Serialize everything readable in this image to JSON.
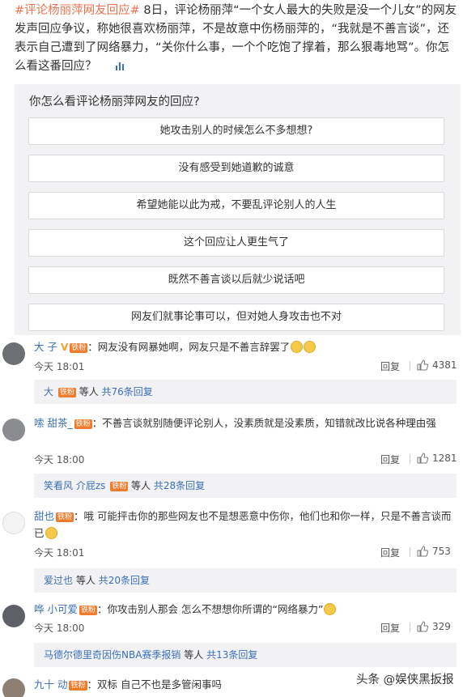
{
  "post": {
    "hashtag": "#评论杨丽萍网友回应#",
    "text": " 8日，评论杨丽萍“一个女人最大的失败是没一个儿女”的网友发声回应争议，称她很喜欢杨丽萍，不是故意中伤杨丽萍的，“我就是不善言谈”，还表示自己遭到了网络暴力，“关你什么事，一个个吃饱了撑着，那么狠毒地骂”。",
    "tail_text": "你怎么看这番回应？"
  },
  "poll": {
    "title": "你怎么看评论杨丽萍网友的回应?",
    "options": [
      "她攻击别人的时候怎么不多想想?",
      "没有感受到她道歉的诚意",
      "希望她能以此为戒，不要乱评论别人的人生",
      "这个回应让人更生气了",
      "既然不善言谈以后就少说话吧",
      "网友们就事论事可以，但对她人身攻击也不对"
    ]
  },
  "comments": [
    {
      "user": "大 子",
      "badge": "V",
      "vip": "铁粉",
      "text": "网友没有网暴她啊，网友只是不善言辞罢了",
      "time": "今天 18:01",
      "reply": "回复",
      "likes": "4381",
      "sub_user": "大",
      "sub_mid": "等人",
      "sub_more": "共76条回复"
    },
    {
      "user": "嗦 甜茶_",
      "vip": "铁粉",
      "text": "不善言谈就别随便评论别人，没素质就是没素质，知错就改比说各种理由强",
      "time": "今天 18:00",
      "reply": "回复",
      "likes": "1281",
      "sub_user": "笑看风 介屁zs",
      "sub_mid": "等人",
      "sub_more": "共28条回复"
    },
    {
      "user": "甜也",
      "vip": "铁粉",
      "text": "哦 可能抨击你的那些网友也不是想恶意中伤你，他们也和你一样，只是不善言谈而已",
      "time": "今天 18:01",
      "reply": "回复",
      "likes": "753",
      "sub_user": "爱过也",
      "sub_mid": "等人",
      "sub_more": "共20条回复"
    },
    {
      "user": "哗 小可爱",
      "vip": "铁粉",
      "text": "你攻击别人那会 怎么不想想你所谓的“网络暴力”",
      "time": "今天 18:00",
      "reply": "回复",
      "likes": "329",
      "sub_user": "马德尔德里奇因伤NBA赛季报销",
      "sub_mid": "等人",
      "sub_more": "共13条回复"
    },
    {
      "user": "九十 动",
      "vip": "铁粉",
      "text": "双标 自己不也是多管闲事吗"
    }
  ],
  "watermark": "头条 @娱侠黑扳报",
  "colors": {
    "link": "#3c6fb5",
    "hashtag": "#eb7350",
    "poll_bg": "#f2f2f5",
    "vip_badge": "#f07c2e"
  },
  "icons": [
    "thumbs-up-icon",
    "chart-icon",
    "emoji-icon"
  ]
}
